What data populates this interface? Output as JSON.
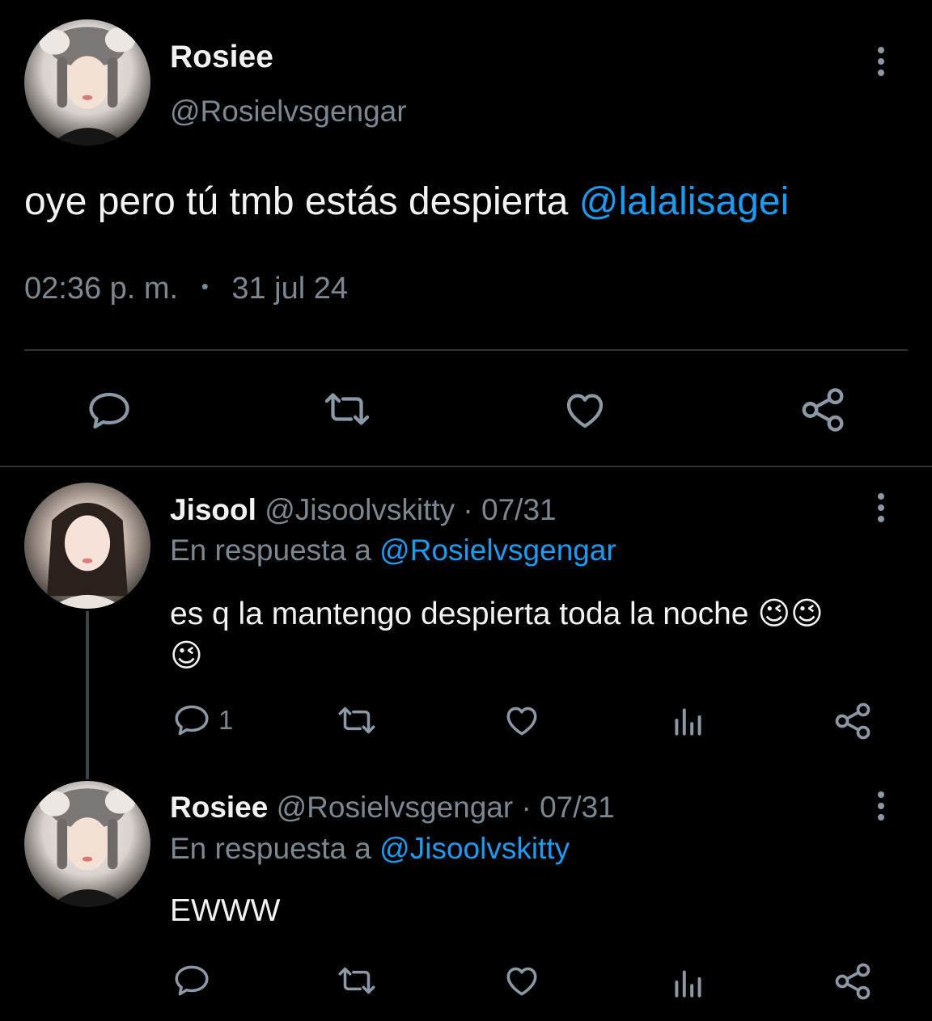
{
  "main_tweet": {
    "display_name": "Rosiee",
    "handle": "@Rosielvsgengar",
    "text": "oye pero tú tmb estás despierta ",
    "mention": "@lalalisagei",
    "time": "02:36 p. m.",
    "separator": "•",
    "date": "31 jul 24",
    "actions": [
      "reply-icon",
      "retweet-icon",
      "like-icon",
      "share-icon"
    ]
  },
  "replies": [
    {
      "display_name": "Jisool",
      "handle": "@Jisoolvskitty",
      "date": "· 07/31",
      "reply_prefix": "En respuesta a ",
      "reply_to": "@Rosielvsgengar",
      "text_line1": "es q la mantengo despierta toda la noche 😉😉",
      "text_line2": "😉",
      "reply_count": "1",
      "actions": [
        "reply-icon",
        "retweet-icon",
        "like-icon",
        "views-icon",
        "share-icon"
      ]
    },
    {
      "display_name": "Rosiee",
      "handle": "@Rosielvsgengar",
      "date": "· 07/31",
      "reply_prefix": "En respuesta a ",
      "reply_to": "@Jisoolvskitty",
      "text_line1": "EWWW",
      "actions": [
        "reply-icon",
        "retweet-icon",
        "like-icon",
        "views-icon",
        "share-icon"
      ]
    }
  ],
  "colors": {
    "background": "#000000",
    "text": "#e7e9ea",
    "muted": "#7b8892",
    "link": "#1d9bf0",
    "divider": "#2f3336"
  }
}
